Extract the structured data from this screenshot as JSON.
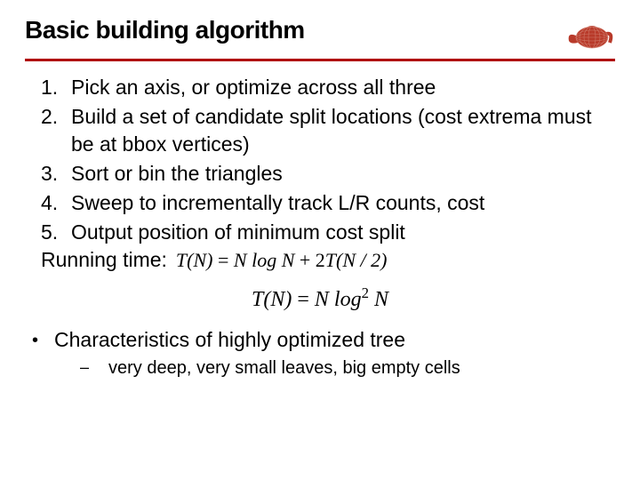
{
  "title": "Basic building algorithm",
  "steps": [
    "Pick an axis, or optimize across all three",
    "Build a set of candidate split locations (cost extrema must be at bbox vertices)",
    "Sort or bin the triangles",
    "Sweep to incrementally track L/R counts, cost",
    "Output position of minimum cost split"
  ],
  "running_label": "Running time:",
  "formula1": {
    "lhs": "T(N)",
    "rhs_a": "N log N",
    "plus": " + 2",
    "rhs_b": "T(N / 2)"
  },
  "formula2": {
    "lhs": "T(N)",
    "rhs": "N log",
    "exp": "2",
    "tail": " N"
  },
  "bullet": {
    "marker": "•",
    "text": "Characteristics of highly optimized tree"
  },
  "sub": {
    "marker": "–",
    "text": "very deep, very small leaves, big empty cells"
  }
}
